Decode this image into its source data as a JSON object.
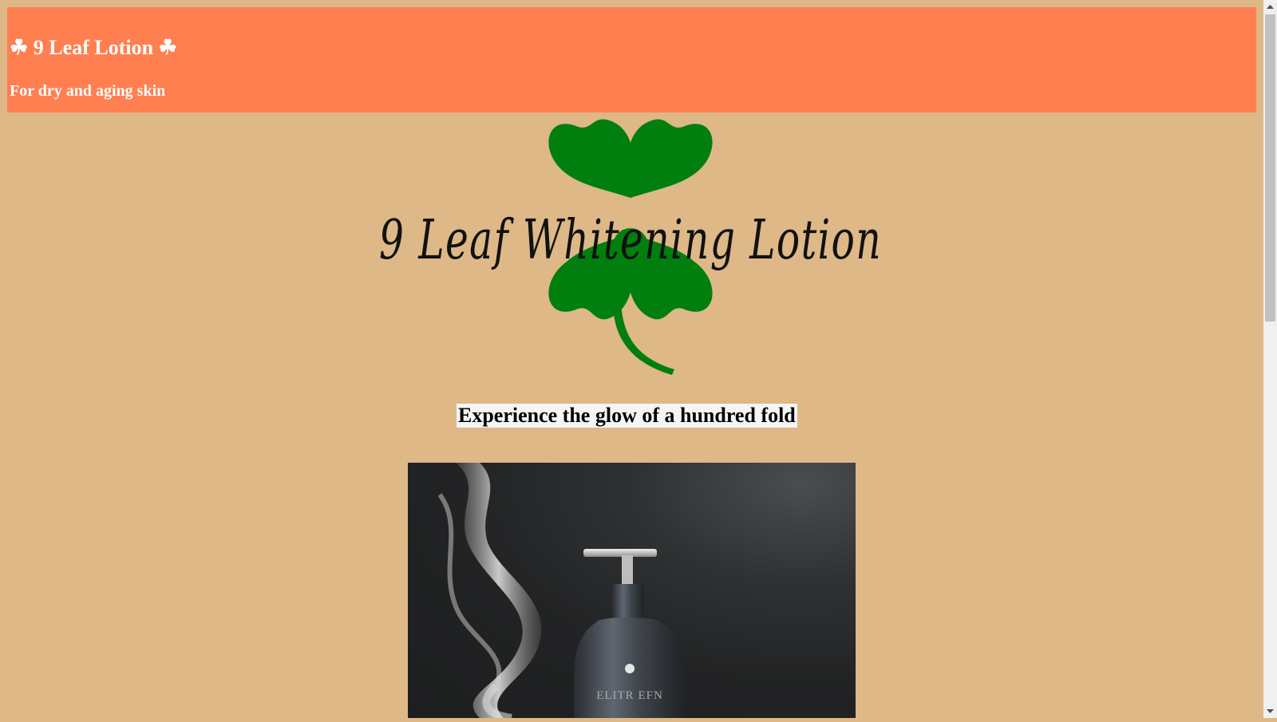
{
  "banner": {
    "title": "☘ 9 Leaf Lotion ☘",
    "subtitle": "For dry and aging skin",
    "background_color": "#ff7f50"
  },
  "logo": {
    "text": "9 Leaf Whitening Lotion",
    "icon": "shamrock-icon",
    "leaf_color": "#007f0e"
  },
  "tagline": "Experience the glow of a hundred fold",
  "product_image": {
    "bottle_label": "ELITR EFN"
  },
  "page": {
    "background_color": "#deb887"
  }
}
